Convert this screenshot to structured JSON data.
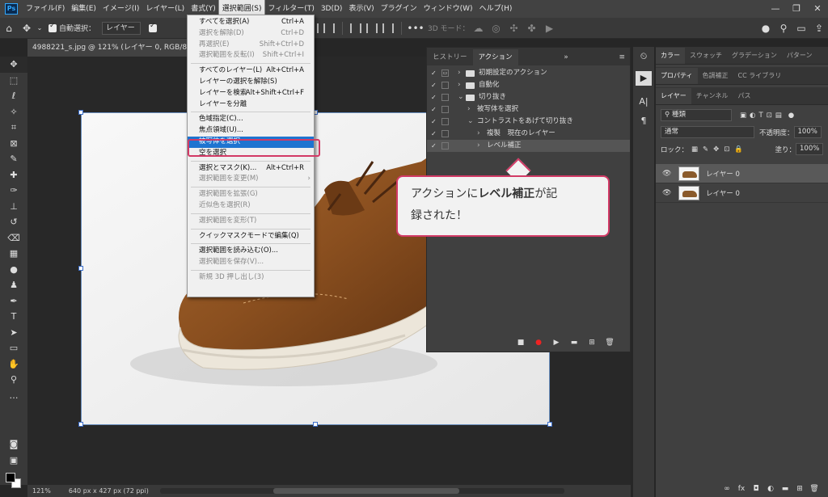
{
  "menubar": {
    "items": [
      "ファイル(F)",
      "編集(E)",
      "イメージ(I)",
      "レイヤー(L)",
      "書式(Y)",
      "選択範囲(S)",
      "フィルター(T)",
      "3D(D)",
      "表示(V)",
      "プラグイン",
      "ウィンドウ(W)",
      "ヘルプ(H)"
    ],
    "active_index": 5,
    "window_controls": [
      "—",
      "❐",
      "✕"
    ]
  },
  "options": {
    "auto_select": "自動選択：",
    "target": "レイヤー",
    "three_d_mode": "3D モード："
  },
  "document": {
    "tab": "4988221_s.jpg @ 121% (レイヤー 0, RGB/8#) *"
  },
  "status": {
    "zoom": "121%",
    "size": "640 px x 427 px (72 ppi)"
  },
  "select_menu": {
    "rows": [
      {
        "label": "すべてを選択(A)",
        "shortcut": "Ctrl+A",
        "disabled": false
      },
      {
        "label": "選択を解除(D)",
        "shortcut": "Ctrl+D",
        "disabled": true
      },
      {
        "label": "再選択(E)",
        "shortcut": "Shift+Ctrl+D",
        "disabled": true
      },
      {
        "label": "選択範囲を反転(I)",
        "shortcut": "Shift+Ctrl+I",
        "disabled": true
      },
      {
        "sep": true
      },
      {
        "label": "すべてのレイヤー(L)",
        "shortcut": "Alt+Ctrl+A",
        "disabled": false
      },
      {
        "label": "レイヤーの選択を解除(S)",
        "shortcut": "",
        "disabled": false
      },
      {
        "label": "レイヤーを検索",
        "shortcut": "Alt+Shift+Ctrl+F",
        "disabled": false
      },
      {
        "label": "レイヤーを分離",
        "shortcut": "",
        "disabled": false
      },
      {
        "sep": true
      },
      {
        "label": "色域指定(C)...",
        "shortcut": "",
        "disabled": false
      },
      {
        "label": "焦点領域(U)...",
        "shortcut": "",
        "disabled": false
      },
      {
        "label": "被写体を選択",
        "shortcut": "",
        "disabled": false,
        "highlight": true
      },
      {
        "label": "空を選択",
        "shortcut": "",
        "disabled": false
      },
      {
        "sep": true
      },
      {
        "label": "選択とマスク(K)...",
        "shortcut": "Alt+Ctrl+R",
        "disabled": false
      },
      {
        "label": "選択範囲を変更(M)",
        "shortcut": "",
        "disabled": true,
        "submenu": true
      },
      {
        "sep": true
      },
      {
        "label": "選択範囲を拡張(G)",
        "shortcut": "",
        "disabled": true
      },
      {
        "label": "近似色を選択(R)",
        "shortcut": "",
        "disabled": true
      },
      {
        "sep": true
      },
      {
        "label": "選択範囲を変形(T)",
        "shortcut": "",
        "disabled": true
      },
      {
        "sep": true
      },
      {
        "label": "クイックマスクモードで編集(Q)",
        "shortcut": "",
        "disabled": false
      },
      {
        "sep": true
      },
      {
        "label": "選択範囲を読み込む(O)...",
        "shortcut": "",
        "disabled": false
      },
      {
        "label": "選択範囲を保存(V)...",
        "shortcut": "",
        "disabled": true
      },
      {
        "sep": true
      },
      {
        "label": "新規 3D 押し出し(3)",
        "shortcut": "",
        "disabled": true
      }
    ]
  },
  "actions_panel": {
    "tabs": [
      "ヒストリー",
      "アクション"
    ],
    "active_tab": 1,
    "more": "»",
    "rows": [
      {
        "label": "初期設定のアクション",
        "level": 0,
        "folder": true,
        "dialog": true,
        "expanded": false
      },
      {
        "label": "自動化",
        "level": 0,
        "folder": true,
        "dialog": false,
        "expanded": false
      },
      {
        "label": "切り抜き",
        "level": 0,
        "folder": true,
        "dialog": false,
        "expanded": true
      },
      {
        "label": "被写体を選択",
        "level": 1,
        "folder": false,
        "dialog": false,
        "expanded": false
      },
      {
        "label": "コントラストをあげて切り抜き",
        "level": 1,
        "folder": false,
        "dialog": false,
        "expanded": true
      },
      {
        "label": "複製　現在のレイヤー",
        "level": 2,
        "folder": false,
        "dialog": false,
        "expanded": false
      },
      {
        "label": "レベル補正",
        "level": 2,
        "folder": false,
        "dialog": false,
        "expanded": false,
        "selected": true
      }
    ]
  },
  "callout": {
    "line1_pre": "アクションに",
    "line1_bold": "レベル補正",
    "line1_post": "が記",
    "line2": "録された！"
  },
  "right_panels": {
    "top_tabs": [
      "カラー",
      "スウォッチ",
      "グラデーション",
      "パターン"
    ],
    "mid_tabs": [
      "プロパティ",
      "色調補正",
      "CC ライブラリ"
    ],
    "layer_tabs": [
      "レイヤー",
      "チャンネル",
      "パス"
    ],
    "kind": "種類",
    "blend": "通常",
    "opacity_label": "不透明度：",
    "opacity": "100%",
    "lock_label": "ロック：",
    "fill_label": "塗り：",
    "fill": "100%",
    "layers": [
      {
        "name": "レイヤー 0",
        "selected": true
      },
      {
        "name": "レイヤー 0",
        "selected": false
      }
    ]
  }
}
